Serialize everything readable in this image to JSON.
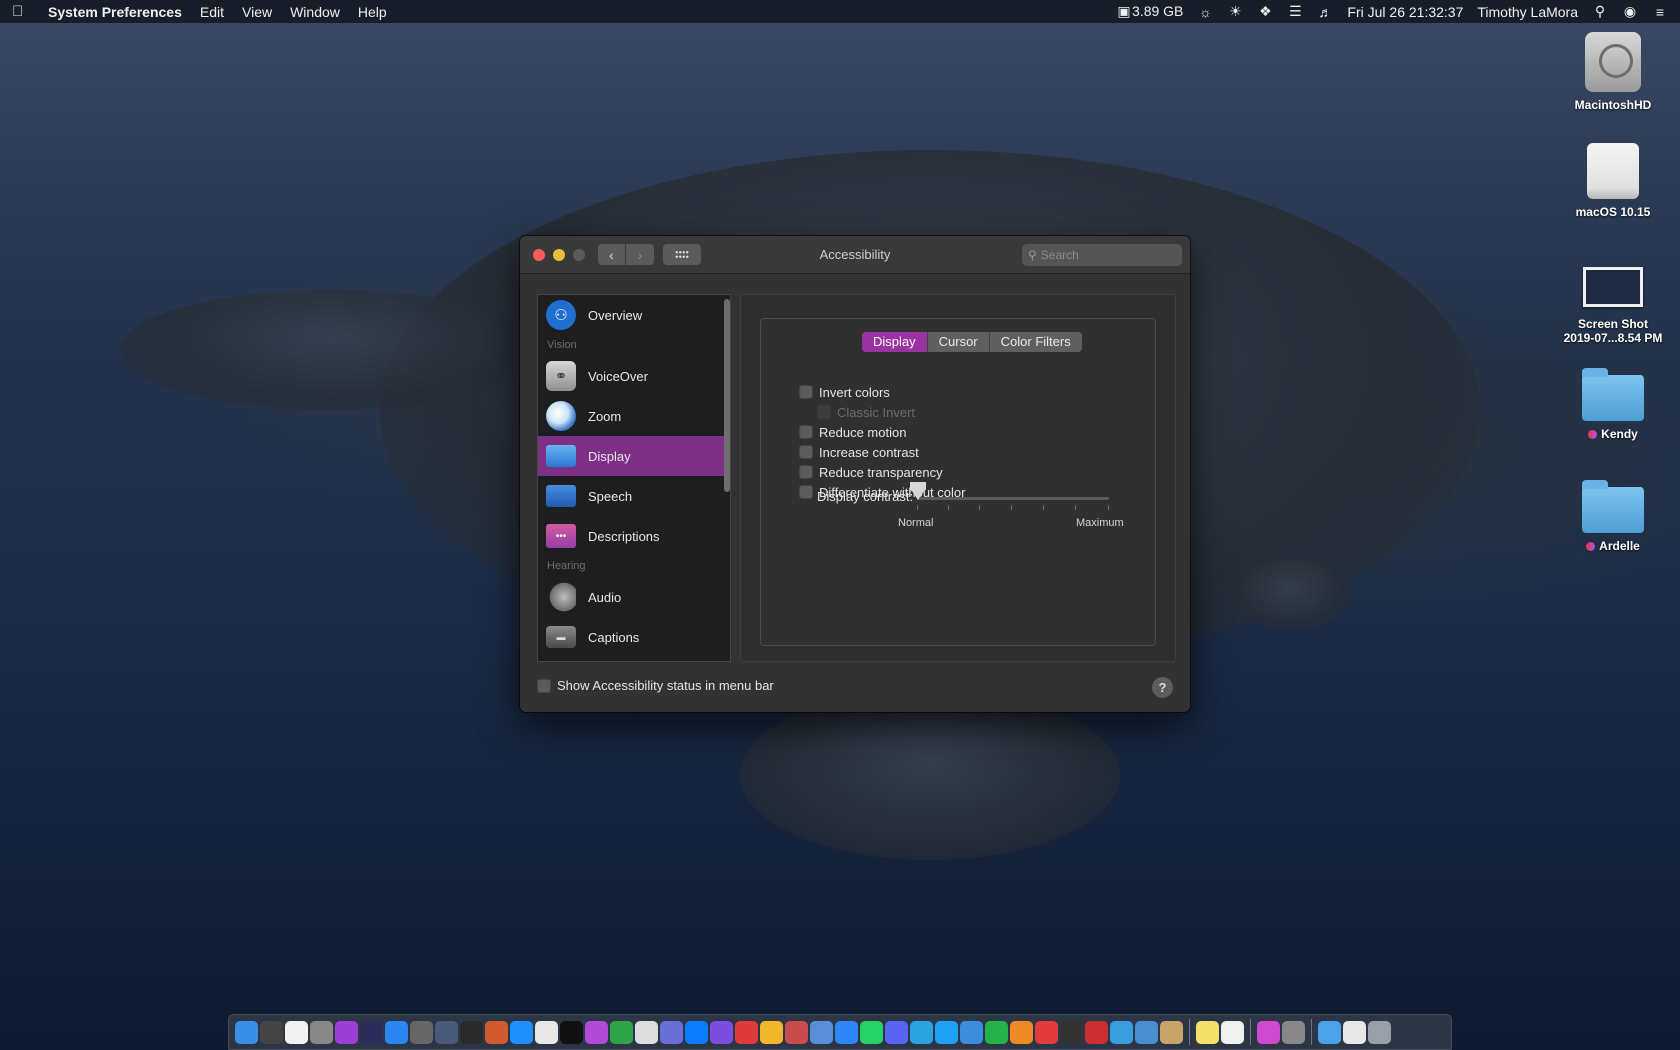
{
  "menubar": {
    "app_name": "System Preferences",
    "menus": [
      "Edit",
      "View",
      "Window",
      "Help"
    ],
    "memory": "3.89 GB",
    "datetime": "Fri Jul 26  21:32:37",
    "user": "Timothy LaMora"
  },
  "desktop": {
    "icons": [
      {
        "label": "MacintoshHD"
      },
      {
        "label": "macOS 10.15"
      },
      {
        "label": "Screen Shot\n2019-07...8.54 PM"
      },
      {
        "label": "Kendy"
      },
      {
        "label": "Ardelle"
      }
    ]
  },
  "window": {
    "title": "Accessibility",
    "search_placeholder": "Search",
    "sidebar": {
      "overview": "Overview",
      "header_vision": "Vision",
      "voiceover": "VoiceOver",
      "zoom": "Zoom",
      "display": "Display",
      "speech": "Speech",
      "descriptions": "Descriptions",
      "header_hearing": "Hearing",
      "audio": "Audio",
      "captions": "Captions"
    },
    "tabs": {
      "display": "Display",
      "cursor": "Cursor",
      "color_filters": "Color Filters"
    },
    "options": {
      "invert_colors": "Invert colors",
      "classic_invert": "Classic Invert",
      "reduce_motion": "Reduce motion",
      "increase_contrast": "Increase contrast",
      "reduce_transparency": "Reduce transparency",
      "differentiate": "Differentiate without color"
    },
    "contrast": {
      "label": "Display contrast:",
      "min_label": "Normal",
      "max_label": "Maximum",
      "value": 0
    },
    "footer": {
      "status_checkbox": "Show Accessibility status in menu bar",
      "help": "?"
    }
  },
  "colors": {
    "accent": "#9a32a3",
    "sidebar_selected": "#7e2f86"
  }
}
